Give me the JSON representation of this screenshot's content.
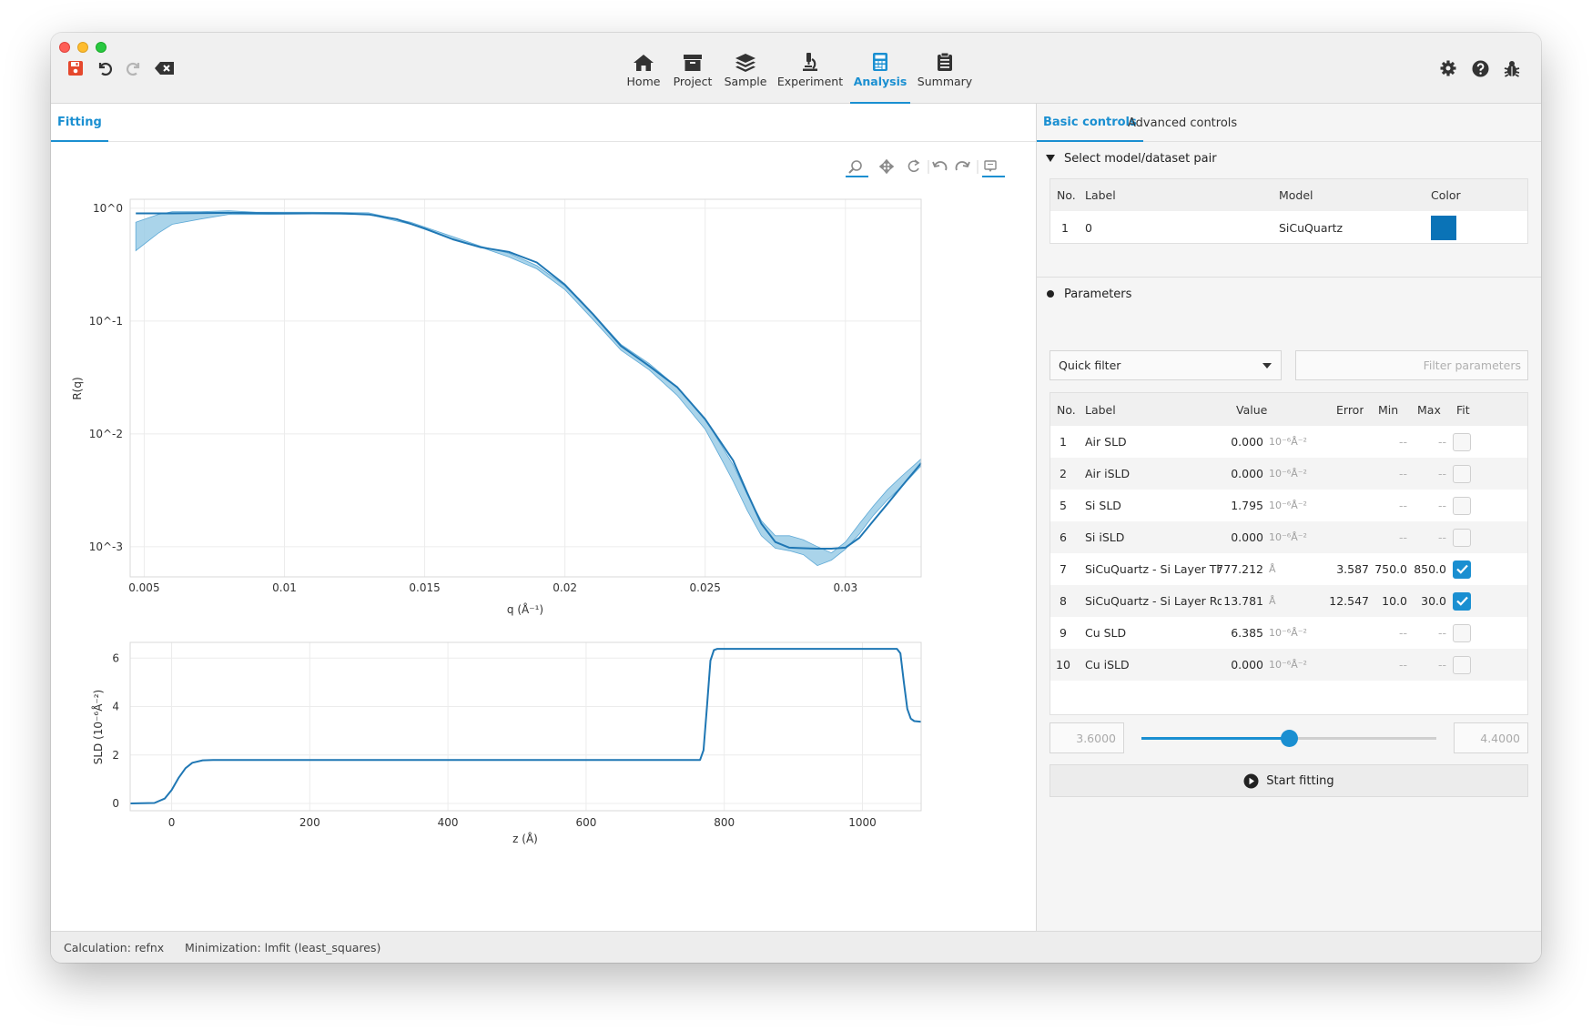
{
  "toolbar": {
    "nav": [
      {
        "label": "Home",
        "icon": "home-icon"
      },
      {
        "label": "Project",
        "icon": "archive-icon"
      },
      {
        "label": "Sample",
        "icon": "layers-icon"
      },
      {
        "label": "Experiment",
        "icon": "microscope-icon"
      },
      {
        "label": "Analysis",
        "icon": "calculator-icon",
        "active": true
      },
      {
        "label": "Summary",
        "icon": "clipboard-icon"
      }
    ],
    "left_icons": [
      "save-icon",
      "undo-icon",
      "redo-icon",
      "clear-icon"
    ],
    "right_icons": [
      "gear-icon",
      "help-icon",
      "bug-icon"
    ],
    "accent_color": "#1a8fd1",
    "save_color": "#e5482d"
  },
  "left_tabs": [
    {
      "label": "Fitting",
      "active": true
    }
  ],
  "right_tabs": [
    {
      "label": "Basic controls",
      "active": true
    },
    {
      "label": "Advanced controls",
      "active": false
    }
  ],
  "model_section": {
    "title": "Select model/dataset pair",
    "headers": [
      "No.",
      "Label",
      "Model",
      "Color"
    ],
    "rows": [
      {
        "no": "1",
        "label": "0",
        "model": "SiCuQuartz",
        "color": "#0a73b7"
      }
    ]
  },
  "params_section": {
    "title": "Parameters",
    "quick_filter": "Quick filter",
    "filter_placeholder": "Filter parameters",
    "headers": [
      "No.",
      "Label",
      "Value",
      "Error",
      "Min",
      "Max",
      "Fit"
    ],
    "rows": [
      {
        "no": "1",
        "label": "Air SLD",
        "value": "0.000",
        "unit": "10⁻⁶Å⁻²",
        "error": "",
        "min": "--",
        "max": "--",
        "fit": false
      },
      {
        "no": "2",
        "label": "Air iSLD",
        "value": "0.000",
        "unit": "10⁻⁶Å⁻²",
        "error": "",
        "min": "--",
        "max": "--",
        "fit": false
      },
      {
        "no": "5",
        "label": "Si SLD",
        "value": "1.795",
        "unit": "10⁻⁶Å⁻²",
        "error": "",
        "min": "--",
        "max": "--",
        "fit": false
      },
      {
        "no": "6",
        "label": "Si iSLD",
        "value": "0.000",
        "unit": "10⁻⁶Å⁻²",
        "error": "",
        "min": "--",
        "max": "--",
        "fit": false
      },
      {
        "no": "7",
        "label": "SiCuQuartz - Si Layer Thi...",
        "value": "777.212",
        "unit": "Å",
        "error": "3.587",
        "min": "750.0",
        "max": "850.0",
        "fit": true
      },
      {
        "no": "8",
        "label": "SiCuQuartz - Si Layer Rou...",
        "value": "13.781",
        "unit": "Å",
        "error": "12.547",
        "min": "10.0",
        "max": "30.0",
        "fit": true
      },
      {
        "no": "9",
        "label": "Cu SLD",
        "value": "6.385",
        "unit": "10⁻⁶Å⁻²",
        "error": "",
        "min": "--",
        "max": "--",
        "fit": false
      },
      {
        "no": "10",
        "label": "Cu iSLD",
        "value": "0.000",
        "unit": "10⁻⁶Å⁻²",
        "error": "",
        "min": "--",
        "max": "--",
        "fit": false
      }
    ],
    "slider": {
      "min_label": "3.6000",
      "max_label": "4.4000",
      "fraction": 0.5
    },
    "start_button": "Start fitting"
  },
  "status": {
    "calculation": "Calculation: refnx",
    "minimization": "Minimization: lmfit (least_squares)"
  },
  "plot_toolbar_icons": [
    "zoom-icon",
    "pan-icon",
    "reset-icon",
    "back-icon",
    "forward-icon",
    "annotate-icon"
  ],
  "chart_data": [
    {
      "type": "line",
      "xlabel": "q (Å⁻¹)",
      "ylabel": "R(q)",
      "yscale": "log",
      "xlim": [
        0.0045,
        0.0327
      ],
      "ylim": [
        0.00054,
        1.2
      ],
      "xticks": [
        "0.005",
        "0.01",
        "0.015",
        "0.02",
        "0.025",
        "0.03"
      ],
      "yticks": [
        "10^0",
        "10^-1",
        "10^-2",
        "10^-3"
      ],
      "grid": true,
      "series": [
        {
          "kind": "band",
          "color": "#8ec5e3",
          "x": [
            0.0047,
            0.0055,
            0.006,
            0.007,
            0.008,
            0.009,
            0.011,
            0.013,
            0.0145,
            0.016,
            0.017,
            0.018,
            0.019,
            0.02,
            0.021,
            0.022,
            0.023,
            0.024,
            0.025,
            0.0255,
            0.026,
            0.0265,
            0.027,
            0.0275,
            0.028,
            0.0285,
            0.029,
            0.0295,
            0.03,
            0.0305,
            0.031,
            0.0315,
            0.032,
            0.0327
          ],
          "upper": [
            0.75,
            0.88,
            0.93,
            0.93,
            0.95,
            0.92,
            0.92,
            0.91,
            0.75,
            0.56,
            0.46,
            0.4,
            0.31,
            0.205,
            0.115,
            0.062,
            0.042,
            0.026,
            0.0135,
            0.0085,
            0.0053,
            0.0029,
            0.0017,
            0.00125,
            0.00125,
            0.00115,
            0.001,
            0.00088,
            0.0011,
            0.0016,
            0.0023,
            0.0032,
            0.0042,
            0.006
          ],
          "lower": [
            0.42,
            0.6,
            0.72,
            0.8,
            0.88,
            0.88,
            0.89,
            0.88,
            0.72,
            0.53,
            0.45,
            0.37,
            0.29,
            0.19,
            0.103,
            0.055,
            0.037,
            0.022,
            0.011,
            0.0065,
            0.0038,
            0.0021,
            0.00125,
            0.00097,
            0.00092,
            0.00085,
            0.00068,
            0.00076,
            0.00095,
            0.0013,
            0.0019,
            0.0026,
            0.0034,
            0.0052
          ]
        },
        {
          "kind": "line",
          "color": "#1f77b4",
          "x": [
            0.0047,
            0.006,
            0.008,
            0.01,
            0.012,
            0.013,
            0.014,
            0.015,
            0.016,
            0.017,
            0.018,
            0.019,
            0.02,
            0.021,
            0.022,
            0.023,
            0.024,
            0.025,
            0.026,
            0.0265,
            0.027,
            0.0275,
            0.028,
            0.0285,
            0.029,
            0.0295,
            0.03,
            0.0305,
            0.031,
            0.0315,
            0.032,
            0.0327
          ],
          "y": [
            0.9,
            0.9,
            0.91,
            0.9,
            0.9,
            0.88,
            0.8,
            0.66,
            0.53,
            0.45,
            0.41,
            0.33,
            0.21,
            0.115,
            0.06,
            0.04,
            0.026,
            0.0135,
            0.0058,
            0.003,
            0.0016,
            0.0011,
            0.00098,
            0.00097,
            0.00096,
            0.00096,
            0.00098,
            0.0012,
            0.0017,
            0.0024,
            0.0034,
            0.0055
          ]
        }
      ]
    },
    {
      "type": "line",
      "xlabel": "z (Å)",
      "ylabel": "SLD (10⁻⁶Å⁻²)",
      "xlim": [
        -60,
        1085
      ],
      "ylim": [
        -0.3,
        6.65
      ],
      "xticks": [
        "0",
        "200",
        "400",
        "600",
        "800",
        "1000"
      ],
      "yticks": [
        "0",
        "2",
        "4",
        "6"
      ],
      "grid": true,
      "series": [
        {
          "color": "#1f77b4",
          "x": [
            -60,
            -25,
            -10,
            0,
            10,
            20,
            30,
            45,
            60,
            765,
            770,
            775,
            780,
            785,
            790,
            1050,
            1055,
            1060,
            1065,
            1070,
            1075,
            1085
          ],
          "y": [
            0,
            0.02,
            0.2,
            0.55,
            1.05,
            1.45,
            1.68,
            1.78,
            1.795,
            1.795,
            2.2,
            4.0,
            5.9,
            6.33,
            6.385,
            6.385,
            6.2,
            5.0,
            3.9,
            3.5,
            3.4,
            3.37
          ]
        }
      ]
    }
  ]
}
